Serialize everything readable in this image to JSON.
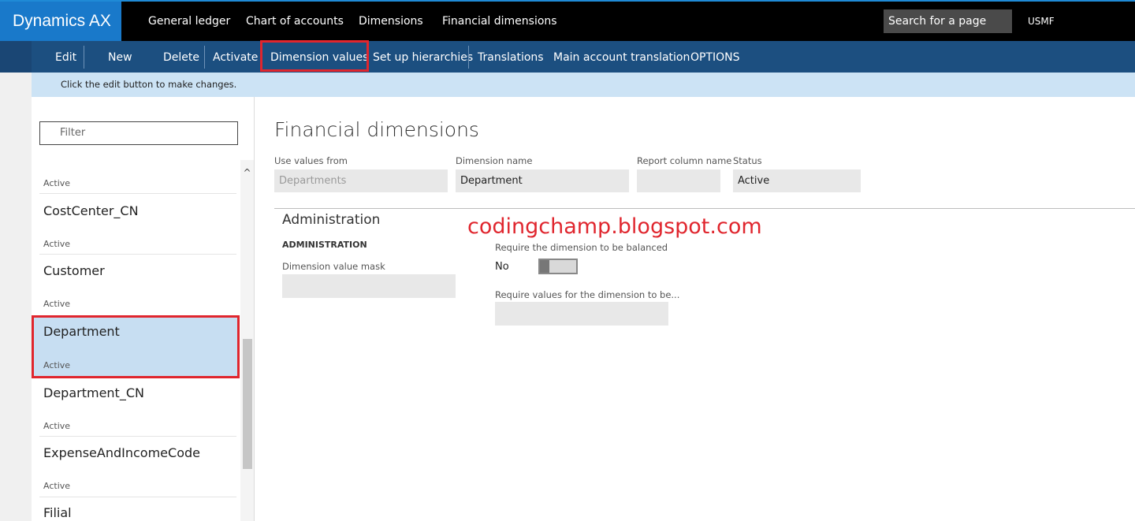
{
  "app": {
    "title": "Dynamics AX"
  },
  "nav": {
    "items": [
      "General ledger",
      "Chart of accounts",
      "Dimensions",
      "Financial dimensions"
    ],
    "search_label": "Search for a page",
    "company": "USMF"
  },
  "actions": {
    "items": [
      "Edit",
      "New",
      "Delete",
      "Activate",
      "Dimension values",
      "Set up hierarchies",
      "Translations",
      "Main account translation",
      "OPTIONS"
    ]
  },
  "info": {
    "message": "Click the edit button to make changes."
  },
  "list": {
    "filter_placeholder": "Filter",
    "scroll_up": "^",
    "items": [
      {
        "title": "",
        "status": "Active"
      },
      {
        "title": "CostCenter_CN",
        "status": "Active"
      },
      {
        "title": "Customer",
        "status": "Active"
      },
      {
        "title": "Department",
        "status": "Active",
        "selected": true
      },
      {
        "title": "Department_CN",
        "status": "Active"
      },
      {
        "title": "ExpenseAndIncomeCode",
        "status": "Active"
      },
      {
        "title": "Filial",
        "status": ""
      }
    ]
  },
  "detail": {
    "title": "Financial dimensions",
    "fields": [
      {
        "label": "Use values from",
        "value": "Departments"
      },
      {
        "label": "Dimension name",
        "value": "Department"
      },
      {
        "label": "Report column name",
        "value": ""
      },
      {
        "label": "Status",
        "value": "Active"
      }
    ],
    "section": {
      "title": "Administration",
      "group": "ADMINISTRATION",
      "mask_label": "Dimension value mask",
      "mask_value": "",
      "balanced_label": "Require the dimension to be balanced",
      "balanced_value": "No",
      "require_values_label": "Require values for the dimension to be...",
      "require_values_value": ""
    }
  },
  "watermark": "codingchamp.blogspot.com",
  "colors": {
    "brand": "#1979ca",
    "action_bar": "#1c4f80",
    "highlight": "#e0262e",
    "info": "#cce3f5",
    "selected": "#c7def2"
  }
}
